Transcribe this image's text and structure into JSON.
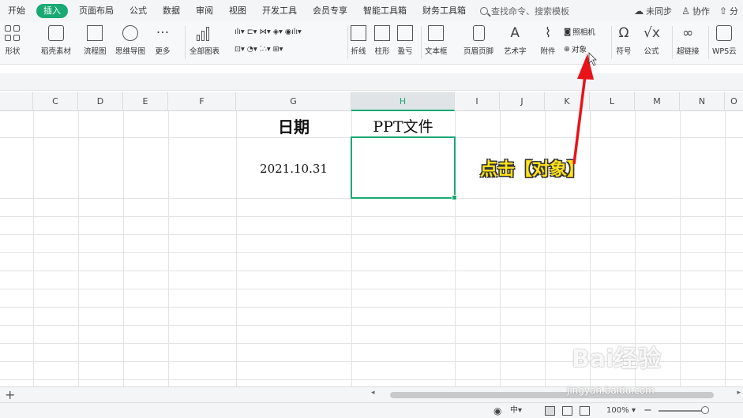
{
  "menubar": {
    "tabs": [
      "开始",
      "插入",
      "页面布局",
      "公式",
      "数据",
      "审阅",
      "视图",
      "开发工具",
      "会员专享",
      "智能工具箱",
      "财务工具箱"
    ],
    "active_tab": "插入",
    "search_placeholder": "查找命令、搜索模板",
    "right": {
      "sync": "未同步",
      "collab": "协作",
      "share": "分"
    }
  },
  "ribbon": {
    "shapes": "形状",
    "materials": "稻壳素材",
    "flowchart": "流程图",
    "mindmap": "思维导图",
    "more": "更多",
    "all_charts": "全部图表",
    "line_chart": "折线",
    "bar_chart": "柱形",
    "win_loss": "盈亏",
    "textbox": "文本框",
    "header_footer": "页眉页脚",
    "wordart": "艺术字",
    "attachment": "附件",
    "camera": "照相机",
    "object": "对象",
    "symbol": "符号",
    "formula": "公式",
    "hyperlink": "超链接",
    "wps_cloud": "WPS云"
  },
  "grid": {
    "columns": [
      "C",
      "D",
      "E",
      "F",
      "G",
      "H",
      "I",
      "J",
      "K",
      "L",
      "M",
      "N",
      "O"
    ],
    "selected_column": "H",
    "cells": {
      "g_header": "日期",
      "h_header": "PPT文件",
      "g_value": "2021.10.31"
    }
  },
  "annotation": {
    "text": "点击【对象】",
    "color": "#ffe21a",
    "arrow_color": "#e8141a"
  },
  "statusbar": {
    "zoom": "100%",
    "minus": "−"
  },
  "watermark": {
    "brand": "Bai经验",
    "site": "jingyan.baidu.com"
  },
  "accent": "#19a974"
}
